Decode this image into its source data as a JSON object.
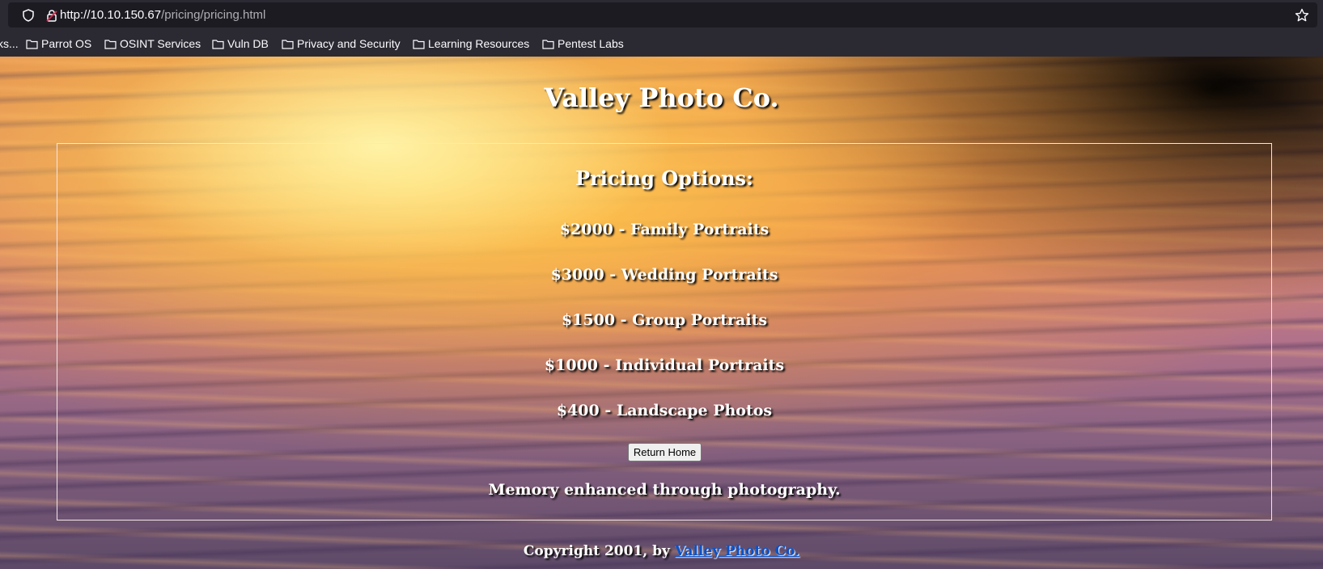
{
  "browser": {
    "url_host": "http://10.10.150.67",
    "url_path": "/pricing/pricing.html",
    "bookmarks": [
      {
        "label": "ks..."
      },
      {
        "label": "Parrot OS"
      },
      {
        "label": "OSINT Services"
      },
      {
        "label": "Vuln DB"
      },
      {
        "label": "Privacy and Security"
      },
      {
        "label": "Learning Resources"
      },
      {
        "label": "Pentest Labs"
      }
    ]
  },
  "page": {
    "title": "Valley Photo Co.",
    "heading": "Pricing Options:",
    "prices": [
      {
        "text": "$2000 - Family Portraits"
      },
      {
        "text": "$3000 - Wedding Portraits"
      },
      {
        "text": "$1500 - Group Portraits"
      },
      {
        "text": "$1000 - Individual Portraits"
      },
      {
        "text": "$400 - Landscape Photos"
      }
    ],
    "return_button": "Return Home",
    "tagline": "Memory enhanced through photography.",
    "footer_prefix": "Copyright 2001, by",
    "footer_link": "Valley Photo Co."
  },
  "icons": {
    "shield": "shield-icon",
    "lock": "insecure-lock-icon",
    "star": "star-icon",
    "folder": "folder-icon"
  },
  "colors": {
    "chrome_bg": "#2b2a33",
    "urlbar_bg": "#1c1b22",
    "footer_link": "#0a52c8"
  }
}
